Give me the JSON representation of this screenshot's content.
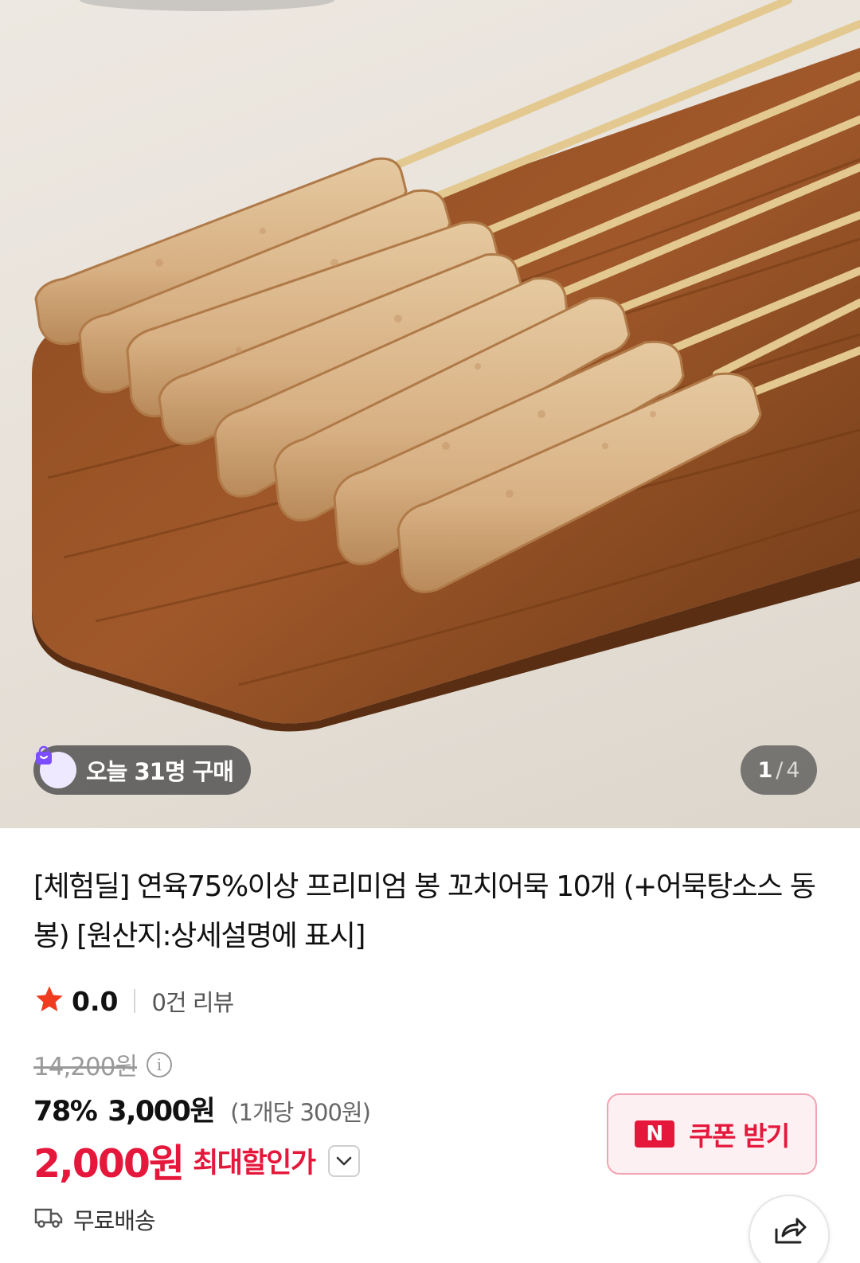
{
  "gallery": {
    "today_purchase": "오늘 31명 구매",
    "current_page": "1",
    "separator": "/",
    "total_pages": "4"
  },
  "product": {
    "title": "[체험딜] 연육75%이상 프리미엄 봉 꼬치어묵 10개 (+어묵탕소스 동봉) [원산지:상세설명에 표시]"
  },
  "rating": {
    "score": "0.0",
    "reviews": "0건 리뷰"
  },
  "price": {
    "original": "14,200원",
    "discount_rate": "78%",
    "sale": "3,000원",
    "unit_price": "(1개당 300원)",
    "max_discount_price": "2,000원",
    "max_discount_label": "최대할인가"
  },
  "coupon": {
    "logo": "N",
    "label": "쿠폰 받기"
  },
  "shipping": {
    "label": "무료배송"
  },
  "colors": {
    "accent_red": "#e5173b",
    "star": "#f03c1e",
    "badge_bg": "#464646"
  },
  "icons": [
    "shopping-bag-icon",
    "star-icon",
    "info-icon",
    "chevron-down-icon",
    "naver-n-icon",
    "truck-icon",
    "share-icon"
  ]
}
